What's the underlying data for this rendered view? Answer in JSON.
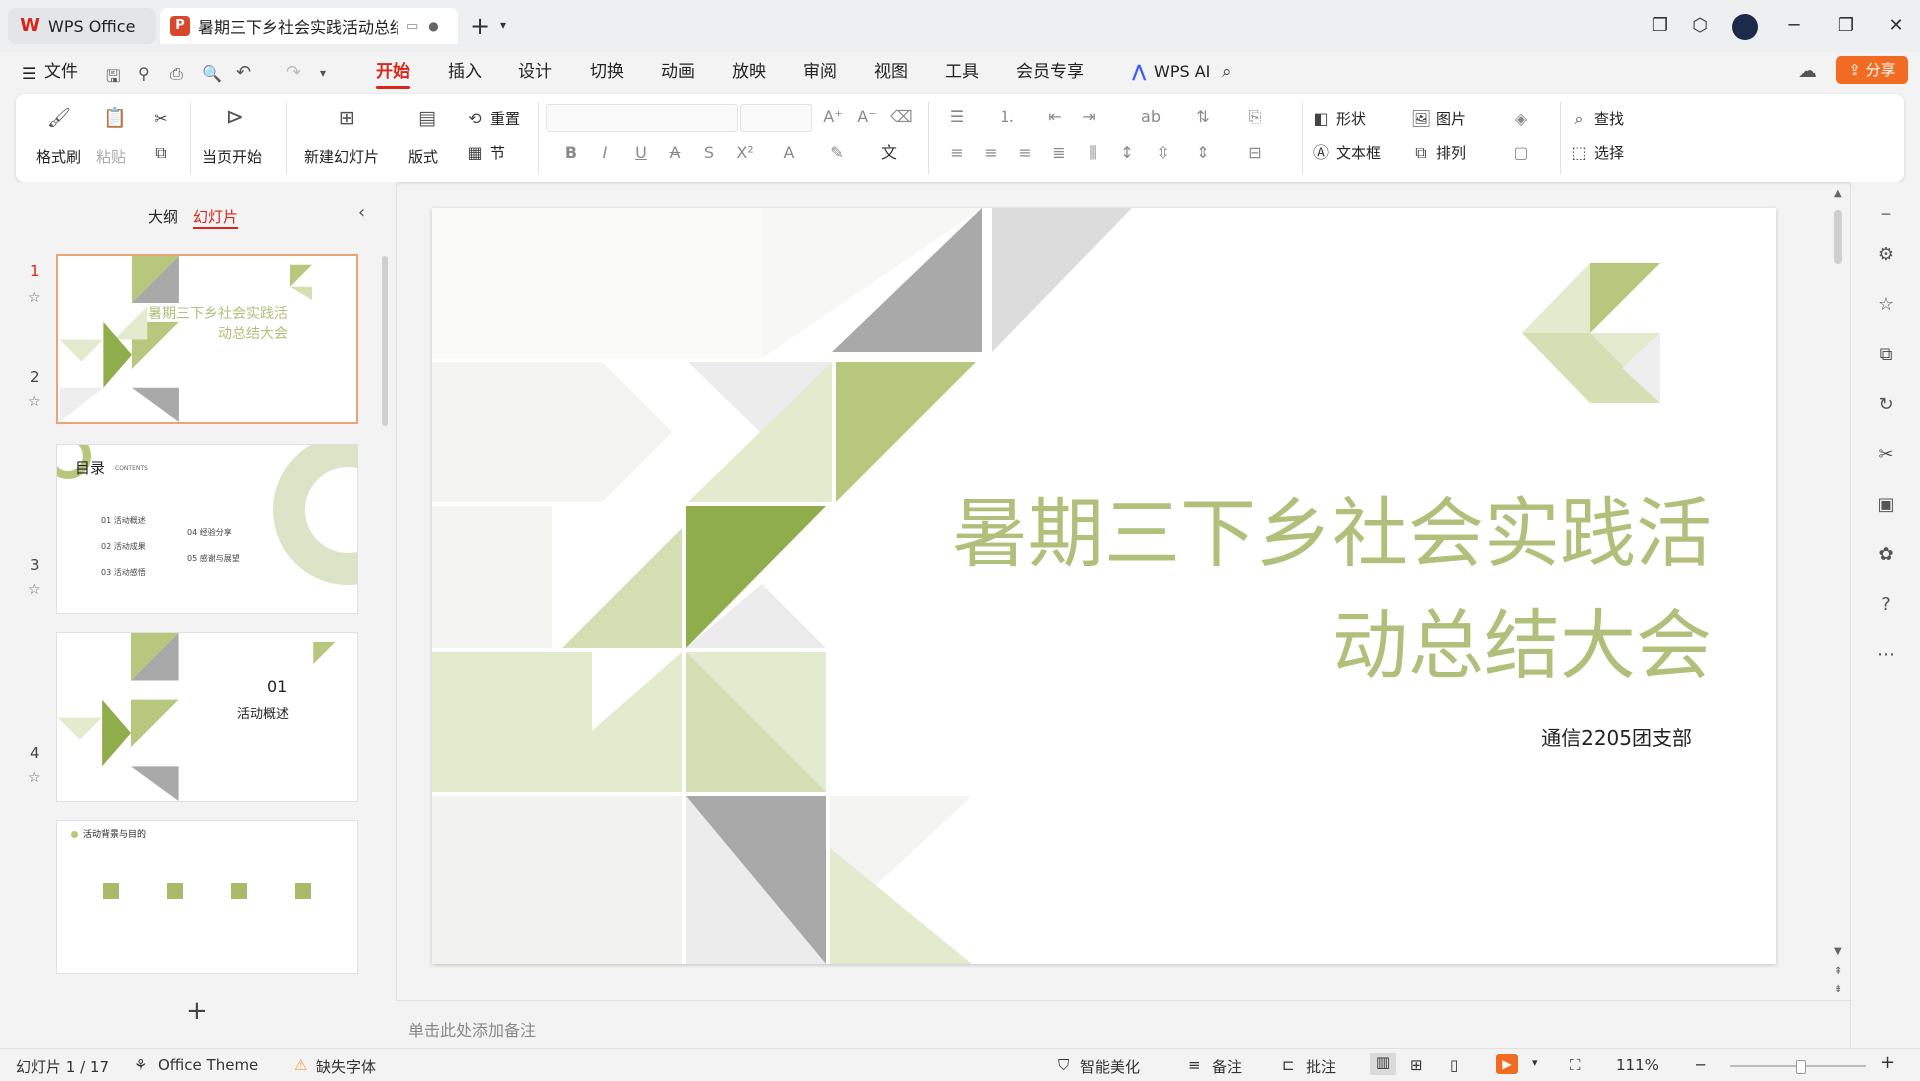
{
  "tabs": {
    "home": "WPS Office",
    "doc": "暑期三下乡社会实践活动总结大会"
  },
  "menu": [
    "文件",
    "开始",
    "插入",
    "设计",
    "切换",
    "动画",
    "放映",
    "审阅",
    "视图",
    "工具",
    "会员专享"
  ],
  "wps_ai": "WPS AI",
  "share": "分享",
  "ribbon": {
    "format_painter": "格式刷",
    "paste": "粘贴",
    "from_current": "当页开始",
    "new_slide": "新建幻灯片",
    "layout": "版式",
    "section": "节",
    "reset": "重置",
    "shape": "形状",
    "picture": "图片",
    "find": "查找",
    "textbox": "文本框",
    "arrange": "排列",
    "select": "选择"
  },
  "panel": {
    "outline": "大纲",
    "slides": "幻灯片"
  },
  "thumbs": {
    "t1_title": "暑期三下乡社会实践活动总结大会",
    "t2_title": "目录",
    "t2_sub": "CONTENTS",
    "t2_items": [
      "01 活动概述",
      "02 活动成果",
      "03 活动感悟",
      "04 经验分享",
      "05 感谢与展望"
    ],
    "t3_num": "01",
    "t3_title": "活动概述",
    "t4_title": "活动背景与目的"
  },
  "slide": {
    "title_line1": "暑期三下乡社会实践活",
    "title_line2": "动总结大会",
    "subtitle": "通信2205团支部"
  },
  "notes_placeholder": "单击此处添加备注",
  "status": {
    "slide_count": "幻灯片 1 / 17",
    "theme": "Office Theme",
    "missing_font": "缺失字体",
    "beautify": "智能美化",
    "notes": "备注",
    "comments": "批注",
    "zoom": "111%"
  },
  "colors": {
    "accent": "#d7261b",
    "green_dark": "#8fad4a",
    "green_mid": "#b7c87e",
    "green_light": "#e3ebcf",
    "title_green": "#b0c07a",
    "gray": "#a9a9a9"
  }
}
